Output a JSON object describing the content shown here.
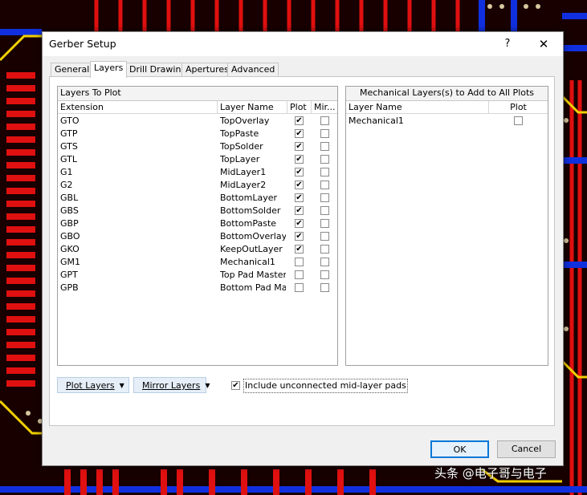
{
  "window": {
    "title": "Gerber Setup",
    "help": "?",
    "close": "✕"
  },
  "tabs": [
    {
      "label": "General",
      "active": false
    },
    {
      "label": "Layers",
      "active": true
    },
    {
      "label": "Drill Drawing",
      "active": false
    },
    {
      "label": "Apertures",
      "active": false
    },
    {
      "label": "Advanced",
      "active": false
    }
  ],
  "layers_panel": {
    "title": "Layers To Plot",
    "columns": {
      "extension": "Extension",
      "layer_name": "Layer Name",
      "plot": "Plot",
      "mirror": "Mir..."
    },
    "rows": [
      {
        "ext": "GTO",
        "name": "TopOverlay",
        "plot": true,
        "mirror": false
      },
      {
        "ext": "GTP",
        "name": "TopPaste",
        "plot": true,
        "mirror": false
      },
      {
        "ext": "GTS",
        "name": "TopSolder",
        "plot": true,
        "mirror": false
      },
      {
        "ext": "GTL",
        "name": "TopLayer",
        "plot": true,
        "mirror": false
      },
      {
        "ext": "G1",
        "name": "MidLayer1",
        "plot": true,
        "mirror": false
      },
      {
        "ext": "G2",
        "name": "MidLayer2",
        "plot": true,
        "mirror": false
      },
      {
        "ext": "GBL",
        "name": "BottomLayer",
        "plot": true,
        "mirror": false
      },
      {
        "ext": "GBS",
        "name": "BottomSolder",
        "plot": true,
        "mirror": false
      },
      {
        "ext": "GBP",
        "name": "BottomPaste",
        "plot": true,
        "mirror": false
      },
      {
        "ext": "GBO",
        "name": "BottomOverlay",
        "plot": true,
        "mirror": false
      },
      {
        "ext": "GKO",
        "name": "KeepOutLayer",
        "plot": true,
        "mirror": false
      },
      {
        "ext": "GM1",
        "name": "Mechanical1",
        "plot": false,
        "mirror": false
      },
      {
        "ext": "GPT",
        "name": "Top Pad Master",
        "plot": false,
        "mirror": false
      },
      {
        "ext": "GPB",
        "name": "Bottom Pad Maste",
        "plot": false,
        "mirror": false
      }
    ]
  },
  "mech_panel": {
    "title": "Mechanical Layers(s) to Add to All Plots",
    "columns": {
      "layer_name": "Layer Name",
      "plot": "Plot"
    },
    "rows": [
      {
        "name": "Mechanical1",
        "plot": false
      }
    ]
  },
  "buttons": {
    "plot_layers": "Plot Layers",
    "mirror_layers": "Mirror Layers",
    "ok": "OK",
    "cancel": "Cancel"
  },
  "options": {
    "include_unconnected": {
      "label": "Include unconnected mid-layer pads",
      "checked": true
    }
  },
  "watermark": "头条 @电子哥与电子",
  "colors": {
    "accent": "#0078d7",
    "pcb_red": "#e01010",
    "pcb_blue": "#1030e0",
    "pcb_yellow": "#f0d000"
  }
}
